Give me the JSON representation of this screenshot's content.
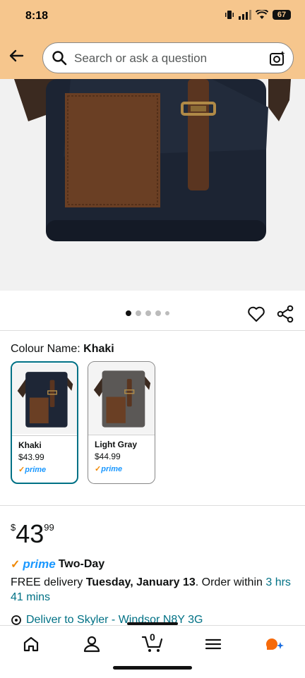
{
  "status": {
    "time": "8:18",
    "battery": "67"
  },
  "header": {
    "search_placeholder": "Search or ask a question"
  },
  "carousel": {
    "dots": 5,
    "active": 0
  },
  "colour": {
    "label": "Colour Name:",
    "selected": "Khaki",
    "options": [
      {
        "name": "Khaki",
        "price": "$43.99",
        "prime": "prime"
      },
      {
        "name": "Light Gray",
        "price": "$44.99",
        "prime": "prime"
      }
    ]
  },
  "price": {
    "symbol": "$",
    "whole": "43",
    "fraction": "99"
  },
  "prime": {
    "word": "prime",
    "label": "Two-Day"
  },
  "delivery": {
    "prefix": "FREE delivery ",
    "date": "Tuesday, January 13",
    "mid": ". Order within ",
    "countdown": "3 hrs 41 mins"
  },
  "deliver_to": "Deliver to Skyler - Windsor N8Y 3G",
  "tabbar": {
    "cart_count": "0"
  },
  "colors": {
    "header_bg": "#f6c68d",
    "teal": "#007185",
    "prime_blue": "#1a98ff",
    "prime_orange": "#f08804"
  }
}
